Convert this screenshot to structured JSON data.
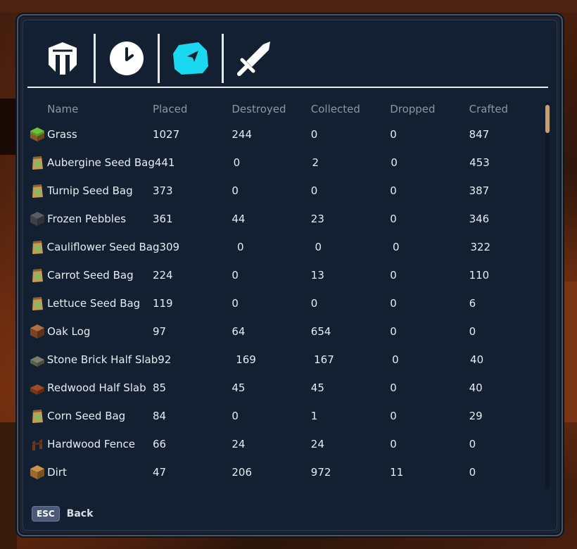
{
  "tabs": [
    {
      "id": "general",
      "icon": "helmet-icon"
    },
    {
      "id": "time",
      "icon": "clock-icon"
    },
    {
      "id": "items",
      "icon": "ore-icon",
      "active": true
    },
    {
      "id": "combat",
      "icon": "sword-icon"
    }
  ],
  "columns": [
    "Name",
    "Placed",
    "Destroyed",
    "Collected",
    "Dropped",
    "Crafted"
  ],
  "rows": [
    {
      "name": "Grass",
      "icon": "grass-block-icon",
      "placed": "1027",
      "destroyed": "244",
      "collected": "0",
      "dropped": "0",
      "crafted": "847"
    },
    {
      "name": "Aubergine Seed Bag",
      "icon": "seed-bag-icon",
      "placed": "441",
      "destroyed": "0",
      "collected": "2",
      "dropped": "0",
      "crafted": "453"
    },
    {
      "name": "Turnip Seed Bag",
      "icon": "seed-bag-icon",
      "placed": "373",
      "destroyed": "0",
      "collected": "0",
      "dropped": "0",
      "crafted": "387"
    },
    {
      "name": "Frozen Pebbles",
      "icon": "pebbles-block-icon",
      "placed": "361",
      "destroyed": "44",
      "collected": "23",
      "dropped": "0",
      "crafted": "346"
    },
    {
      "name": "Cauliflower Seed Bag",
      "icon": "seed-bag-icon",
      "placed": "309",
      "destroyed": "0",
      "collected": "0",
      "dropped": "0",
      "crafted": "322"
    },
    {
      "name": "Carrot Seed Bag",
      "icon": "seed-bag-icon",
      "placed": "224",
      "destroyed": "0",
      "collected": "13",
      "dropped": "0",
      "crafted": "110"
    },
    {
      "name": "Lettuce Seed Bag",
      "icon": "seed-bag-icon",
      "placed": "119",
      "destroyed": "0",
      "collected": "0",
      "dropped": "0",
      "crafted": "6"
    },
    {
      "name": "Oak Log",
      "icon": "log-block-icon",
      "placed": "97",
      "destroyed": "64",
      "collected": "654",
      "dropped": "0",
      "crafted": "0"
    },
    {
      "name": "Stone Brick Half Slab",
      "icon": "stone-slab-icon",
      "placed": "92",
      "destroyed": "169",
      "collected": "167",
      "dropped": "0",
      "crafted": "40"
    },
    {
      "name": "Redwood Half Slab",
      "icon": "wood-slab-icon",
      "placed": "85",
      "destroyed": "45",
      "collected": "45",
      "dropped": "0",
      "crafted": "40"
    },
    {
      "name": "Corn Seed Bag",
      "icon": "seed-bag-icon",
      "placed": "84",
      "destroyed": "0",
      "collected": "1",
      "dropped": "0",
      "crafted": "29"
    },
    {
      "name": "Hardwood Fence",
      "icon": "fence-icon",
      "placed": "66",
      "destroyed": "24",
      "collected": "24",
      "dropped": "0",
      "crafted": "0"
    },
    {
      "name": "Dirt",
      "icon": "dirt-block-icon",
      "placed": "47",
      "destroyed": "206",
      "collected": "972",
      "dropped": "11",
      "crafted": "0"
    }
  ],
  "footer": {
    "key": "ESC",
    "label": "Back"
  },
  "colors": {
    "active_tab": "#19d8f0",
    "panel": "#132031",
    "text": "#e8ecf2",
    "header": "#8b96a6"
  }
}
